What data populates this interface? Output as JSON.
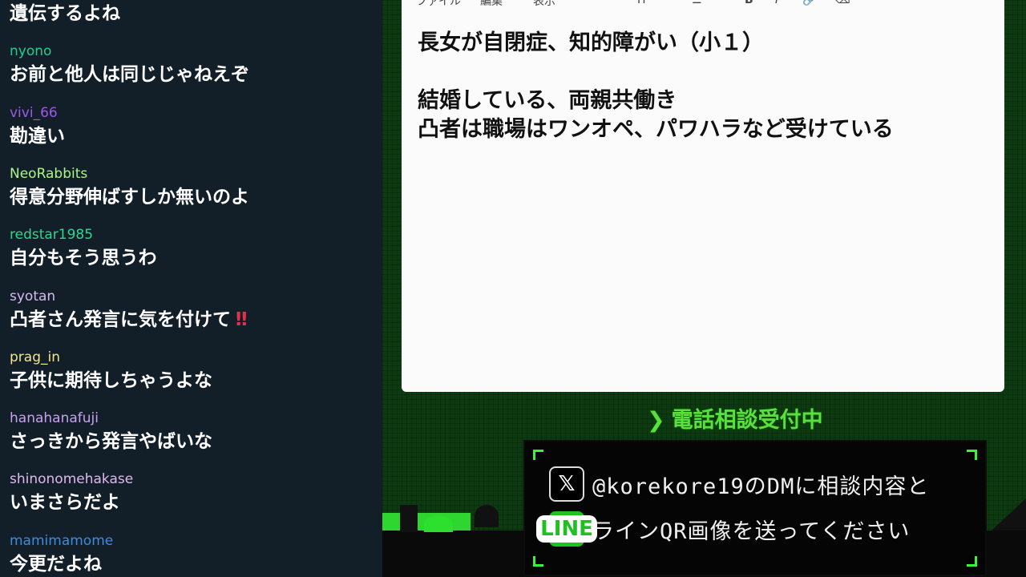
{
  "chat": {
    "messages": [
      {
        "user": "",
        "text": "遺伝するよね",
        "color": "#ffffff"
      },
      {
        "user": "nyono",
        "text": "お前と他人は同じじゃねえぞ",
        "color": "#1fce8e"
      },
      {
        "user": "vivi_66",
        "text": "勘違い",
        "color": "#9b59e8"
      },
      {
        "user": "NeoRabbits",
        "text": "得意分野伸ばすしか無いのよ",
        "color": "#a9f58a"
      },
      {
        "user": "redstar1985",
        "text": "自分もそう思うわ",
        "color": "#2fd68f"
      },
      {
        "user": "syotan",
        "text": "凸者さん発言に気を付けて",
        "color": "#d7b9f2",
        "emoji": "‼"
      },
      {
        "user": "prag_in",
        "text": "子供に期待しちゃうよな",
        "color": "#f0e68c"
      },
      {
        "user": "hanahanafuji",
        "text": "さっきから発言やばいな",
        "color": "#c8a0f0"
      },
      {
        "user": "shinonomehakase",
        "text": "いまさらだよ",
        "color": "#e0b8f0"
      },
      {
        "user": "mamimamome",
        "text": "今更だよね",
        "color": "#3c8ddf"
      }
    ]
  },
  "notepad": {
    "menu": [
      "ファイル",
      "編集",
      "表示"
    ],
    "toolbar_icons": [
      "heading-icon",
      "list-icon",
      "bold-icon",
      "italic-icon",
      "link-icon",
      "clear-format-icon"
    ],
    "lines": [
      "長女が自閉症、知的障がい（小１）",
      "",
      "結婚している、両親共働き",
      "凸者は職場はワンオペ、パワハラなど受けている"
    ]
  },
  "overlay": {
    "status": "電話相談受付中",
    "x_line": "@korekore19のDMに相談内容と",
    "line_line": "ラインQR画像を送ってください",
    "line_icon_label": "LINE"
  }
}
